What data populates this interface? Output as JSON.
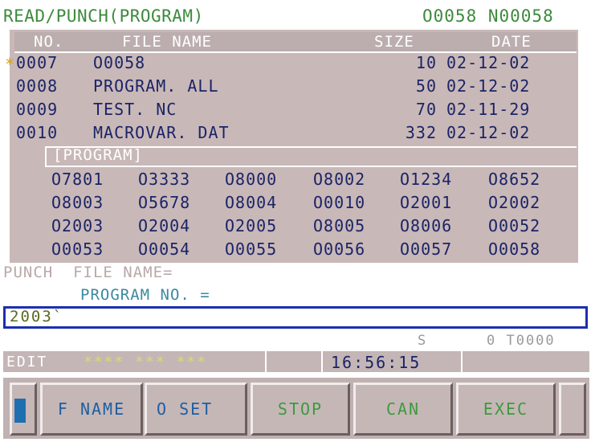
{
  "header": {
    "title": "READ/PUNCH(PROGRAM)",
    "program_info": "O0058 N00058"
  },
  "file_table": {
    "columns": [
      "NO.",
      "FILE NAME",
      "SIZE",
      "DATE"
    ],
    "rows": [
      {
        "marker": "*",
        "no": "0007",
        "name": "O0058",
        "size": "10",
        "date": "02-12-02"
      },
      {
        "marker": "",
        "no": "0008",
        "name": "PROGRAM. ALL",
        "size": "50",
        "date": "02-12-02"
      },
      {
        "marker": "",
        "no": "0009",
        "name": "TEST. NC",
        "size": "70",
        "date": "02-11-29"
      },
      {
        "marker": "",
        "no": "0010",
        "name": "MACROVAR. DAT",
        "size": "332",
        "date": "02-12-02"
      }
    ]
  },
  "program_list": {
    "label": "[PROGRAM]",
    "rows": [
      [
        "O7801",
        "O3333",
        "O8000",
        "O8002",
        "O1234",
        "O8652"
      ],
      [
        "O8003",
        "O5678",
        "O8004",
        "O0010",
        "O2001",
        "O2002"
      ],
      [
        "O2003",
        "O2004",
        "O2005",
        "O8005",
        "O8006",
        "O0052"
      ],
      [
        "O0053",
        "O0054",
        "O0055",
        "O0056",
        "O0057",
        "O0058"
      ]
    ]
  },
  "punch": {
    "file_name_label": "PUNCH  FILE NAME=",
    "program_no_label": "PROGRAM NO. ="
  },
  "input": {
    "value": "2003`"
  },
  "status": {
    "s_label": "S",
    "s_value": "0 T0000"
  },
  "edit_bar": {
    "mode": "EDIT",
    "stars": "**** *** ***",
    "clock": "16:56:15"
  },
  "softkeys": {
    "left_nav": "(",
    "fname": "F NAME",
    "oset": "O SET",
    "stop": "STOP",
    "can": "CAN",
    "exec": "EXEC",
    "right_nav": ""
  },
  "colors": {
    "panel": "#c9b8b8",
    "input_border": "#1e2fb0",
    "softkey_text": "#3d9a3d"
  }
}
